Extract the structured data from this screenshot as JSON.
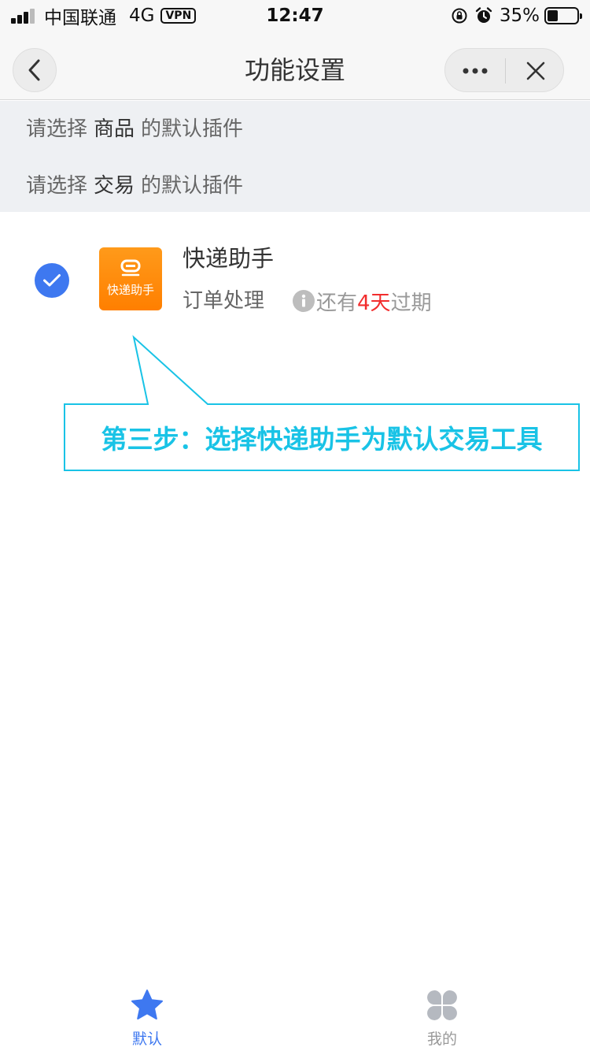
{
  "status_bar": {
    "carrier": "中国联通",
    "network": "4G",
    "vpn": "VPN",
    "time": "12:47",
    "battery": "35%",
    "battery_level": 0.35
  },
  "nav": {
    "title": "功能设置"
  },
  "prompts": [
    {
      "prefix": "请选择",
      "keyword": "商品",
      "suffix": "的默认插件"
    },
    {
      "prefix": "请选择",
      "keyword": "交易",
      "suffix": "的默认插件"
    }
  ],
  "plugin": {
    "icon_label": "快递助手",
    "name": "快递助手",
    "description": "订单处理",
    "expiry_prefix": "还有",
    "expiry_days": "4天",
    "expiry_suffix": "过期",
    "selected": true
  },
  "annotation": {
    "text": "第三步：选择快递助手为默认交易工具",
    "color": "#19c3e6"
  },
  "tabs": [
    {
      "label": "默认",
      "icon": "star-icon",
      "active": true
    },
    {
      "label": "我的",
      "icon": "grid-icon",
      "active": false
    }
  ],
  "colors": {
    "accent": "#3e78f0",
    "icon_orange": "#ff8a00",
    "expiry_red": "#f22d2d"
  }
}
